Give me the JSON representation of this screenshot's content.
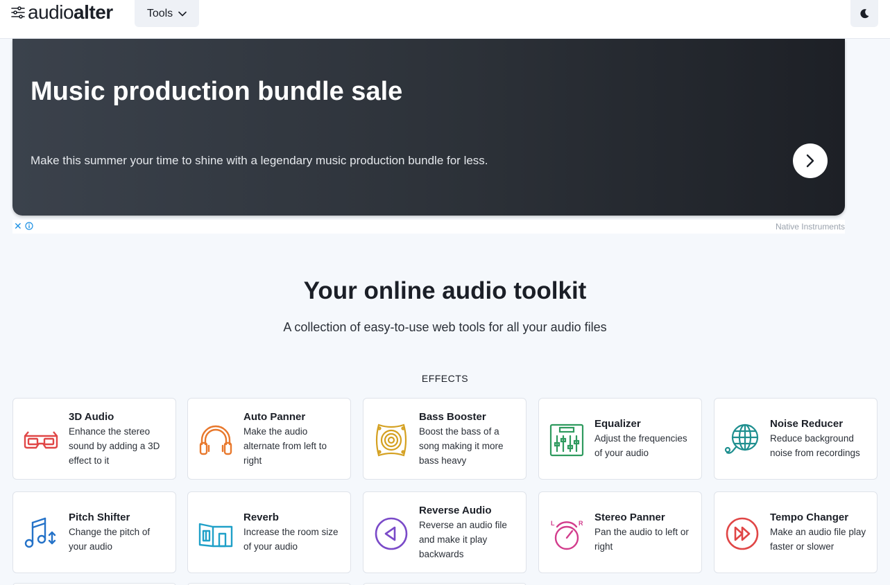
{
  "header": {
    "logo_part1": "audio",
    "logo_part2": "alter",
    "tools_label": "Tools"
  },
  "ad": {
    "title": "Music production bundle sale",
    "subtitle": "Make this summer your time to shine with a legendary music production bundle for less.",
    "close_glyph": "✕",
    "sponsor": "Native Instruments"
  },
  "hero": {
    "title": "Your online audio toolkit",
    "subtitle": "A collection of easy-to-use web tools for all your audio files"
  },
  "section": {
    "label": "EFFECTS"
  },
  "tools": [
    {
      "name": "3D Audio",
      "desc": "Enhance the stereo sound by adding a 3D effect to it",
      "icon": "3d-glasses-icon",
      "color": "#e04646"
    },
    {
      "name": "Auto Panner",
      "desc": "Make the audio alternate from left to right",
      "icon": "headphones-icon",
      "color": "#e8782c"
    },
    {
      "name": "Bass Booster",
      "desc": "Boost the bass of a song making it more bass heavy",
      "icon": "speaker-icon",
      "color": "#d4a020"
    },
    {
      "name": "Equalizer",
      "desc": "Adjust the frequencies of your audio",
      "icon": "equalizer-icon",
      "color": "#2e9a5e"
    },
    {
      "name": "Noise Reducer",
      "desc": "Reduce background noise from recordings",
      "icon": "globe-mic-icon",
      "color": "#1e8f8f"
    },
    {
      "name": "Pitch Shifter",
      "desc": "Change the pitch of your audio",
      "icon": "music-note-arrows-icon",
      "color": "#2472c8"
    },
    {
      "name": "Reverb",
      "desc": "Increase the room size of your audio",
      "icon": "room-icon",
      "color": "#1fa0c8"
    },
    {
      "name": "Reverse Audio",
      "desc": "Reverse an audio file and make it play backwards",
      "icon": "reverse-icon",
      "color": "#7a4ac8"
    },
    {
      "name": "Stereo Panner",
      "desc": "Pan the audio to left or right",
      "icon": "pan-knob-icon",
      "color": "#d23c8c"
    },
    {
      "name": "Tempo Changer",
      "desc": "Make an audio file play faster or slower",
      "icon": "fast-forward-icon",
      "color": "#e04646"
    }
  ]
}
